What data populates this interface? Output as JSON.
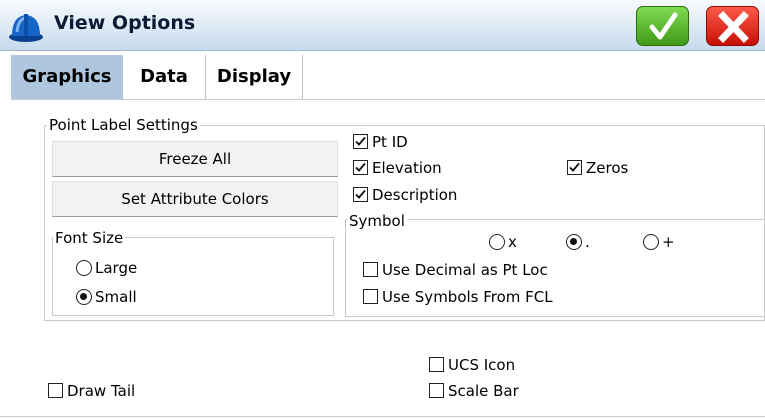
{
  "window": {
    "title": "View Options"
  },
  "tabs": [
    {
      "label": "Graphics",
      "active": true
    },
    {
      "label": "Data",
      "active": false
    },
    {
      "label": "Display",
      "active": false
    }
  ],
  "point_label_settings": {
    "label": "Point Label Settings",
    "freeze_all": "Freeze All",
    "set_attribute_colors": "Set Attribute Colors",
    "font_size": {
      "label": "Font Size",
      "options": [
        {
          "label": "Large",
          "selected": false
        },
        {
          "label": "Small",
          "selected": true
        }
      ]
    },
    "checkboxes": {
      "pt_id": {
        "label": "Pt ID",
        "checked": true
      },
      "elevation": {
        "label": "Elevation",
        "checked": true
      },
      "zeros": {
        "label": "Zeros",
        "checked": true
      },
      "description": {
        "label": "Description",
        "checked": true
      }
    },
    "symbol": {
      "label": "Symbol",
      "options": [
        {
          "label": "x",
          "selected": false
        },
        {
          "label": ".",
          "selected": true
        },
        {
          "label": "+",
          "selected": false
        }
      ],
      "use_decimal": {
        "label": "Use Decimal as Pt Loc",
        "checked": false
      },
      "use_symbols_fcl": {
        "label": "Use Symbols From FCL",
        "checked": false
      }
    }
  },
  "bottom": {
    "draw_tail": {
      "label": "Draw Tail",
      "checked": false
    },
    "ucs_icon": {
      "label": "UCS Icon",
      "checked": false
    },
    "scale_bar": {
      "label": "Scale Bar",
      "checked": false
    }
  },
  "colors": {
    "active_tab": "#aec6de",
    "ok_green": "#3f9a17",
    "cancel_red": "#c70f05"
  },
  "icons": {
    "app": "hard-hat-icon",
    "ok": "check-icon",
    "cancel": "close-icon"
  }
}
